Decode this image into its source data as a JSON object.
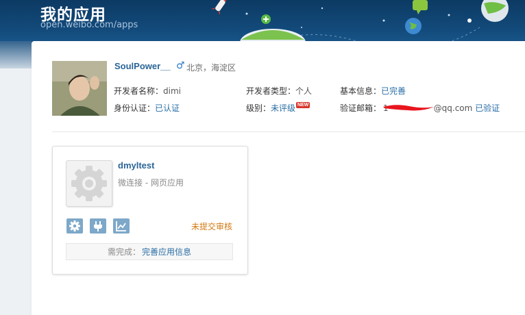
{
  "header": {
    "title": "我的应用",
    "url": "open.weibo.com/apps"
  },
  "profile": {
    "username": "SoulPower__",
    "gender_symbol": "♂",
    "location": "北京，海淀区",
    "developer_name_label": "开发者名称：",
    "developer_name": "dimi",
    "developer_type_label": "开发者类型：",
    "developer_type": "个人",
    "basic_info_label": "基本信息：",
    "basic_info_status": "已完善",
    "identity_label": "身份认证：",
    "identity_status": "已认证",
    "level_label": "级别：",
    "level_value": "未评级",
    "level_badge": "NEW",
    "email_label": "验证邮箱：",
    "email_prefix": "1",
    "email_visible": "@qq.com",
    "email_status": "已验证"
  },
  "app": {
    "name": "dmyltest",
    "type": "微连接 - 网页应用",
    "status": "未提交审核",
    "todo_label": "需完成：",
    "todo_link": "完善应用信息",
    "tools": [
      "gear-icon",
      "plug-icon",
      "chart-icon"
    ]
  },
  "colors": {
    "link": "#2a6ea6",
    "status_orange": "#d27a12",
    "tool_button": "#7da8c9",
    "banner": "#134b7c"
  }
}
